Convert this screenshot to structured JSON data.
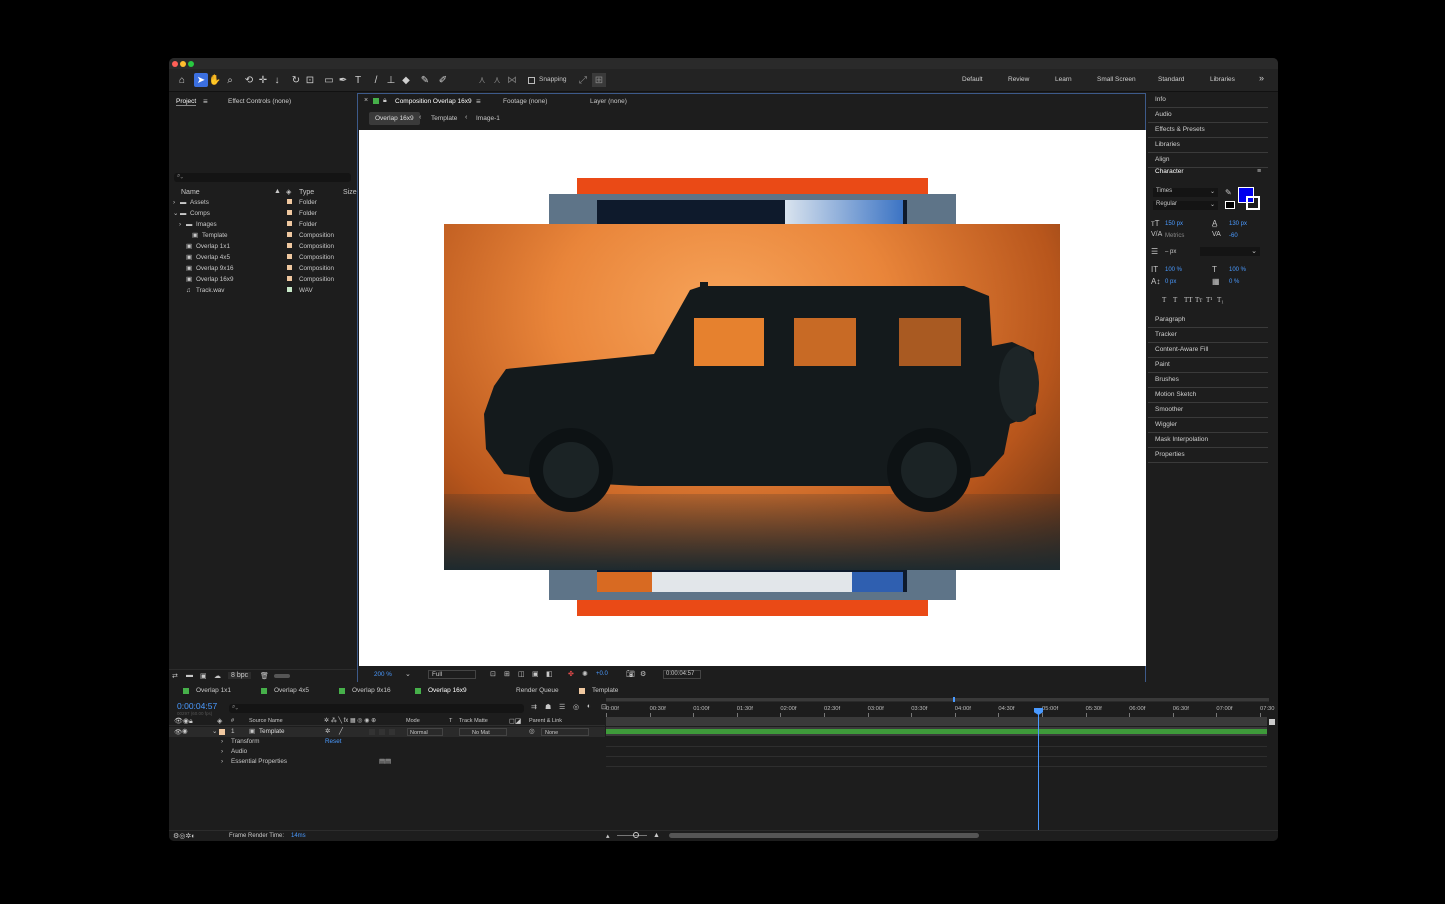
{
  "toolbar": {
    "snapping_label": "Snapping",
    "workspaces": [
      "Default",
      "Review",
      "Learn",
      "Small Screen",
      "Standard",
      "Libraries"
    ],
    "more": "»"
  },
  "project": {
    "tabs": [
      "Project",
      "Effect Controls (none)"
    ],
    "search_placeholder": "",
    "columns": [
      "Name",
      "Type",
      "Size"
    ],
    "items": [
      {
        "name": "Assets",
        "type": "Folder",
        "color": "#f0c8a0",
        "kind": "folder"
      },
      {
        "name": "Comps",
        "type": "Folder",
        "color": "#f0c8a0",
        "kind": "folder"
      },
      {
        "name": "Images",
        "type": "Folder",
        "color": "#f0c8a0",
        "kind": "folder"
      },
      {
        "name": "Template",
        "type": "Composition",
        "color": "#f0c8a0",
        "kind": "comp"
      },
      {
        "name": "Overlap 1x1",
        "type": "Composition",
        "color": "#f0c8a0",
        "kind": "comp"
      },
      {
        "name": "Overlap 4x5",
        "type": "Composition",
        "color": "#f0c8a0",
        "kind": "comp"
      },
      {
        "name": "Overlap 9x16",
        "type": "Composition",
        "color": "#f0c8a0",
        "kind": "comp"
      },
      {
        "name": "Overlap 16x9",
        "type": "Composition",
        "color": "#f0c8a0",
        "kind": "comp"
      },
      {
        "name": "Track.wav",
        "type": "WAV",
        "color": "#c8e8c8",
        "kind": "audio"
      }
    ],
    "bpc": "8 bpc"
  },
  "viewer": {
    "tabs": [
      "Composition Overlap 16x9",
      "Footage (none)",
      "Layer (none)"
    ],
    "breadcrumbs": [
      "Overlap 16x9",
      "Template",
      "Image-1"
    ],
    "zoom": "200 %",
    "resolution": "Full",
    "exposure": "+0.0",
    "timecode": "0:00:04:57"
  },
  "right_panels": {
    "top": [
      "Info",
      "Audio",
      "Effects & Presets",
      "Libraries",
      "Align"
    ],
    "character": {
      "title": "Character",
      "font": "Times",
      "style": "Regular",
      "size": "150 px",
      "leading": "130 px",
      "kerning": "Metrics",
      "tracking": "-60",
      "stroke": "– px",
      "vscale": "100 %",
      "hscale": "100 %",
      "baseline": "0 px",
      "tsume": "0 %",
      "fill_color": "#0000ee",
      "styles": [
        "T",
        "T",
        "TT",
        "Tт",
        "T¹",
        "T₁"
      ]
    },
    "bottom": [
      "Paragraph",
      "Tracker",
      "Content-Aware Fill",
      "Paint",
      "Brushes",
      "Motion Sketch",
      "Smoother",
      "Wiggler",
      "Mask Interpolation",
      "Properties"
    ]
  },
  "timeline": {
    "tabs": [
      {
        "label": "Overlap 1x1",
        "color": "#46b04a"
      },
      {
        "label": "Overlap 4x5",
        "color": "#46b04a"
      },
      {
        "label": "Overlap 9x16",
        "color": "#46b04a"
      },
      {
        "label": "Overlap 16x9",
        "color": "#46b04a"
      },
      {
        "label": "Render Queue",
        "color": ""
      },
      {
        "label": "Template",
        "color": "#f0c8a0"
      }
    ],
    "current_time": "0:00:04:57",
    "fps": "00297 (60.00 fps)",
    "headers": [
      "#",
      "Source Name",
      "Mode",
      "T",
      "Track Matte",
      "Parent & Link"
    ],
    "layer": {
      "num": "1",
      "name": "Template",
      "mode": "Normal",
      "matte": "No Mat",
      "parent": "None"
    },
    "props": [
      {
        "name": "Transform",
        "value": "Reset"
      },
      {
        "name": "Audio",
        "value": ""
      },
      {
        "name": "Essential Properties",
        "value": ""
      }
    ],
    "ruler": [
      "0:00f",
      "00:30f",
      "01:00f",
      "01:30f",
      "02:00f",
      "02:30f",
      "03:00f",
      "03:30f",
      "04:00f",
      "04:30f",
      "05:00f",
      "05:30f",
      "06:00f",
      "06:30f",
      "07:00f",
      "07:30"
    ],
    "frame_render_label": "Frame Render Time:",
    "frame_render_value": "14ms"
  },
  "colors": {
    "accent": "#3b8cff",
    "layer_bar": "#3e9a3a",
    "orange": "#e85a1a"
  }
}
